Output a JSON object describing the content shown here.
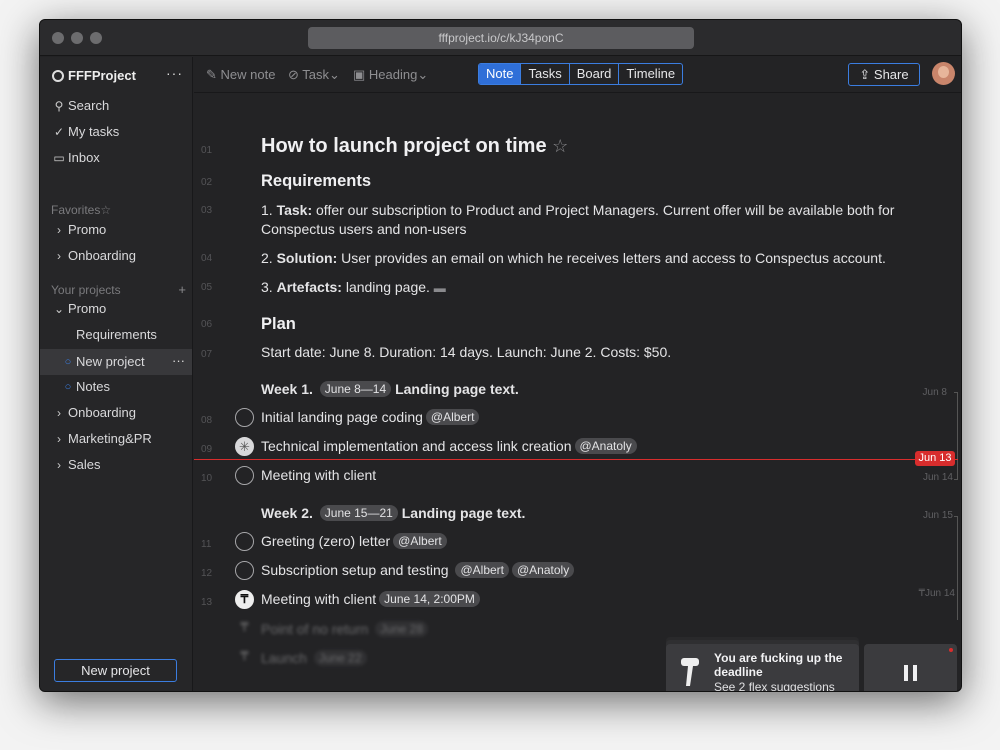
{
  "window": {
    "url": "fffproject.io/c/kJ34ponC"
  },
  "sidebar": {
    "brand": "FFFProject",
    "more": "···",
    "nav": [
      {
        "icon": "search-icon",
        "label": "Search"
      },
      {
        "icon": "check-circle-icon",
        "label": "My tasks"
      },
      {
        "icon": "inbox-icon",
        "label": "Inbox"
      }
    ],
    "favorites_label": "Favorites",
    "favorites": [
      "Promo",
      "Onboarding"
    ],
    "projects_label": "Your projects",
    "projects_plus": "+",
    "projects": [
      {
        "label": "Promo",
        "expanded": true
      },
      {
        "label": "Requirements"
      },
      {
        "label": "New project",
        "selected": true
      },
      {
        "label": "Notes"
      },
      {
        "label": "Onboarding"
      },
      {
        "label": "Marketing&PR"
      },
      {
        "label": "Sales"
      }
    ],
    "new_project": "New project"
  },
  "toolbar": {
    "new_note": "New note",
    "task": "Task",
    "heading": "Heading",
    "views": [
      "Note",
      "Tasks",
      "Board",
      "Timeline"
    ],
    "active_view": "Note",
    "share": "Share"
  },
  "doc": {
    "title": "How to launch project on time",
    "requirements_heading": "Requirements",
    "req1_prefix": "1. ",
    "req1_bold": "Task:",
    "req1_text": " offer our subscription to Product and Project Managers. Current offer will be available both for Conspectus users and non-users",
    "req2_prefix": "2. ",
    "req2_bold": "Solution:",
    "req2_text": " User provides an email on which he receives letters and access to Conspectus account.",
    "req3_prefix": "3. ",
    "req3_bold": "Artefacts:",
    "req3_text": " landing page.",
    "plan_heading": "Plan",
    "plan_text": "Start date: June 8. Duration: 14 days. Launch: June 2. Costs: $50.",
    "week1_label": "Week 1.",
    "week1_range": "June 8—14",
    "week1_title": "Landing page text.",
    "task_coding": "Initial landing page coding",
    "tag_albert": "@Albert",
    "task_tech": "Technical implementation and access link creation",
    "tag_anatoly": "@Anatoly",
    "task_meeting1": "Meeting with client",
    "week2_label": "Week 2.",
    "week2_range": "June 15—21",
    "week2_title": "Landing page text.",
    "task_greeting": "Greeting (zero) letter",
    "task_subscription": "Subscription setup and testing",
    "task_meeting2": "Meeting with client",
    "meeting2_time": "June 14, 2:00PM",
    "task_ponr": "Point of no return",
    "ponr_date": "June 28",
    "task_launch": "Launch",
    "launch_date": "June 22"
  },
  "line_numbers": [
    "01",
    "02",
    "03",
    "04",
    "05",
    "06",
    "07",
    "08",
    "09",
    "10",
    "11",
    "12",
    "13"
  ],
  "dates": {
    "jun8": "Jun 8",
    "jun13": "Jun 13",
    "jun14": "Jun 14",
    "jun15": "Jun 15",
    "jun14b": "Jun 14"
  },
  "toast": {
    "title": "You are fucking up the deadline",
    "link": "See 2 flex suggestions"
  },
  "colors": {
    "accent": "#3b7de0",
    "today": "#d82d2d",
    "bg": "#232325"
  }
}
